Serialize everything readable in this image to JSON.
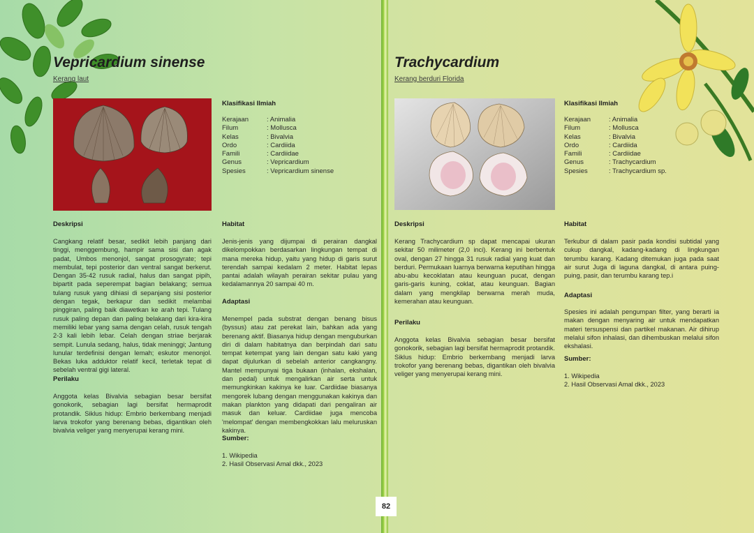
{
  "page_number": "82",
  "left": {
    "title": "Vepricardium sinense",
    "subtitle": "Kerang laut",
    "klasifikasi": {
      "heading": "Klasifikasi Ilmiah",
      "rows": [
        {
          "k": "Kerajaan",
          "v": ": Animalia"
        },
        {
          "k": "Filum",
          "v": ": Mollusca"
        },
        {
          "k": "Kelas",
          "v": ": Bivalvia"
        },
        {
          "k": "Ordo",
          "v": ": Cardiida"
        },
        {
          "k": "Famili",
          "v": ": Cardiidae"
        },
        {
          "k": "Genus",
          "v": ": Vepricardium"
        },
        {
          "k": "Spesies",
          "v": ": Vepricardium sinense"
        }
      ]
    },
    "deskripsi": {
      "heading": "Deskripsi",
      "text": "Cangkang relatif besar, sedikit lebih panjang dari tinggi, menggembung, hampir sama sisi dan agak padat, Umbos menonjol, sangat prosogyrate; tepi membulat, tepi posterior dan ventral sangat berkerut. Dengan 35-42 rusuk radial, halus dan sangat pipih, bipartit pada seperempat bagian belakang; semua tulang rusuk yang dihiasi di sepanjang sisi posterior dengan tegak, berkapur dan sedikit melambai pinggiran, paling baik diawetkan ke arah tepi. Tulang rusuk paling depan dan paling belakang dari kira-kira memiliki lebar yang sama dengan celah, rusuk tengah 2-3 kali lebih lebar. Celah dengan striae berjarak sempit. Lunula sedang, halus, tidak meninggi; Jantung lunular terdefinisi dengan lemah; eskutor menonjol. Bekas luka adduktor relatif kecil, terletak tepat di sebelah ventral gigi lateral."
    },
    "perilaku": {
      "heading": "Perilaku",
      "text": "Anggota kelas Bivalvia sebagian besar bersifat gonokorik, sebagian lagi bersifat hermaprodit protandik. Siklus hidup: Embrio berkembang menjadi larva trokofor yang berenang bebas, digantikan oleh bivalvia veliger yang menyerupai kerang mini."
    },
    "habitat": {
      "heading": "Habitat",
      "text": "Jenis-jenis yang dijumpai di perairan dangkal dikelompokkan berdasarkan lingkungan tempat di mana mereka hidup, yaitu yang hidup di garis surut terendah sampai kedalam 2 meter. Habitat lepas pantai adalah wilayah perairan sekitar pulau yang kedalamannya 20 sampai 40 m."
    },
    "adaptasi": {
      "heading": "Adaptasi",
      "text": "Menempel pada substrat dengan benang bisus (byssus) atau zat perekat lain, bahkan ada yang berenang aktif. Biasanya hidup dengan menguburkan diri di dalam habitatnya dan berpindah dari satu tempat ketempat yang lain dengan satu kaki yang dapat dijulurkan di sebelah anterior cangkangny. Mantel mempunyai tiga bukaan (inhalan, ekshalan, dan pedal) untuk mengalirkan air serta untuk memungkinkan kakinya ke luar. Cardiidae biasanya mengorek lubang dengan menggunakan kakinya dan makan plankton yang didapati dari pengaliran air masuk dan keluar. Cardiidae juga mencoba 'melompat' dengan membengkokkan lalu meluruskan kakinya."
    },
    "sumber": {
      "heading": "Sumber:",
      "items": [
        "1. Wikipedia",
        "2. Hasil Observasi Amal dkk., 2023"
      ]
    }
  },
  "right": {
    "title": "Trachycardium",
    "subtitle": "Kerang berduri Florida",
    "klasifikasi": {
      "heading": "Klasifikasi Ilmiah",
      "rows": [
        {
          "k": "Kerajaan",
          "v": ": Animalia"
        },
        {
          "k": "Filum",
          "v": ": Mollusca"
        },
        {
          "k": "Kelas",
          "v": ": Bivalvia"
        },
        {
          "k": "Ordo",
          "v": ": Cardiida"
        },
        {
          "k": "Famili",
          "v": ": Cardiidae"
        },
        {
          "k": "Genus",
          "v": ": Trachycardium"
        },
        {
          "k": "Spesies",
          "v": ": Trachycardium sp."
        }
      ]
    },
    "deskripsi": {
      "heading": "Deskripsi",
      "text": "Kerang Trachycardium sp dapat mencapai ukuran sekitar 50 milimeter (2,0 inci). Kerang ini berbentuk oval, dengan 27 hingga 31 rusuk radial yang kuat dan berduri. Permukaan luarnya berwarna keputihan hingga abu-abu kecoklatan atau keunguan pucat, dengan garis-garis kuning, coklat, atau keunguan. Bagian dalam yang mengkilap berwarna merah muda, kemerahan atau keunguan."
    },
    "perilaku": {
      "heading": "Perilaku",
      "text": "Anggota kelas Bivalvia sebagian besar bersifat gonokorik, sebagian lagi bersifat hermaprodit protandik. Siklus hidup: Embrio berkembang menjadi larva trokofor yang berenang bebas, digantikan oleh bivalvia veliger yang menyerupai kerang mini."
    },
    "habitat": {
      "heading": "Habitat",
      "text": "Terkubur di dalam pasir pada kondisi subtidal yang cukup dangkal, kadang-kadang di lingkungan terumbu karang. Kadang ditemukan juga pada saat air surut Juga di laguna dangkal, di antara puing-puing, pasir, dan terumbu karang tep.i"
    },
    "adaptasi": {
      "heading": "Adaptasi",
      "text": "Spesies ini adalah pengumpan filter, yang berarti ia makan dengan menyaring air untuk mendapatkan materi tersuspensi dan partikel makanan. Air dihirup melalui sifon inhalasi, dan dihembuskan melalui sifon ekshalasi."
    },
    "sumber": {
      "heading": "Sumber:",
      "items": [
        "1. Wikipedia",
        "2. Hasil Observasi Amal dkk., 2023"
      ]
    }
  }
}
